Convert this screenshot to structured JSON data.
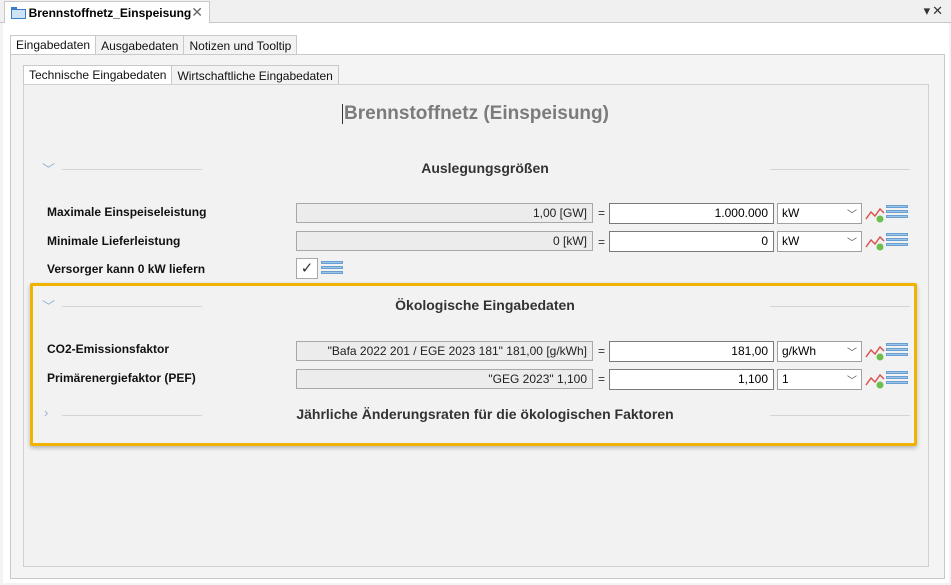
{
  "editor_tab": {
    "title": "Brennstoffnetz_Einspeisung"
  },
  "outer_tabs": [
    "Eingabedaten",
    "Ausgabedaten",
    "Notizen und Tooltip"
  ],
  "inner_tabs": [
    "Technische Eingabedaten",
    "Wirtschaftliche Eingabedaten"
  ],
  "page_title": "Brennstoffnetz (Einspeisung)",
  "sections": {
    "auslegung": "Auslegungsgrößen",
    "oeko": "Ökologische Eingabedaten",
    "aenderung": "Jährliche Änderungsraten für die ökologischen Faktoren"
  },
  "rows": {
    "max_einspeise": {
      "label": "Maximale Einspeiseleistung",
      "readonly": "1,00 [GW]",
      "value": "1.000.000",
      "unit": "kW"
    },
    "min_liefer": {
      "label": "Minimale Lieferleistung",
      "readonly": "0 [kW]",
      "value": "0",
      "unit": "kW"
    },
    "versorger": {
      "label": "Versorger kann 0 kW liefern",
      "checked": true
    },
    "co2": {
      "label": "CO2-Emissionsfaktor",
      "readonly": "\"Bafa 2022 201 / EGE 2023 181\" 181,00 [g/kWh]",
      "value": "181,00",
      "unit": "g/kWh"
    },
    "pef": {
      "label": "Primärenergiefaktor (PEF)",
      "readonly": "\"GEG 2023\" 1,100",
      "value": "1,100",
      "unit": "1"
    }
  },
  "equals": "=",
  "icons": {
    "tab_icon": "folder-icon",
    "chart": "chart-add-icon",
    "list": "list-icon",
    "chevron": "chevron-icon"
  },
  "colors": {
    "highlight": "#f0b400",
    "section_chevron": "#9ab3cf"
  }
}
